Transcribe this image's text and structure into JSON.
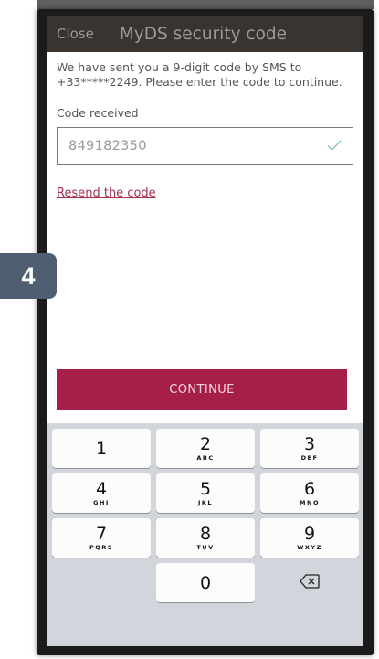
{
  "header": {
    "close_label": "Close",
    "title": "MyDS security code"
  },
  "info_text": "We have sent you a 9-digit code by SMS to +33*****2249. Please enter the code to continue.",
  "code": {
    "label": "Code received",
    "value": "849182350",
    "status": "valid"
  },
  "resend_label": "Resend the code",
  "continue_label": "CONTINUE",
  "step_badge": "4",
  "keypad": {
    "k1": {
      "digit": "1",
      "letters": ""
    },
    "k2": {
      "digit": "2",
      "letters": "ABC"
    },
    "k3": {
      "digit": "3",
      "letters": "DEF"
    },
    "k4": {
      "digit": "4",
      "letters": "GHI"
    },
    "k5": {
      "digit": "5",
      "letters": "JKL"
    },
    "k6": {
      "digit": "6",
      "letters": "MNO"
    },
    "k7": {
      "digit": "7",
      "letters": "PQRS"
    },
    "k8": {
      "digit": "8",
      "letters": "TUV"
    },
    "k9": {
      "digit": "9",
      "letters": "WXYZ"
    },
    "k0": {
      "digit": "0",
      "letters": ""
    }
  },
  "colors": {
    "header_bg": "#3a3430",
    "accent": "#a51f48",
    "link": "#a8304f",
    "badge_bg": "#4f5f71",
    "valid_check": "#8cc9a5"
  }
}
